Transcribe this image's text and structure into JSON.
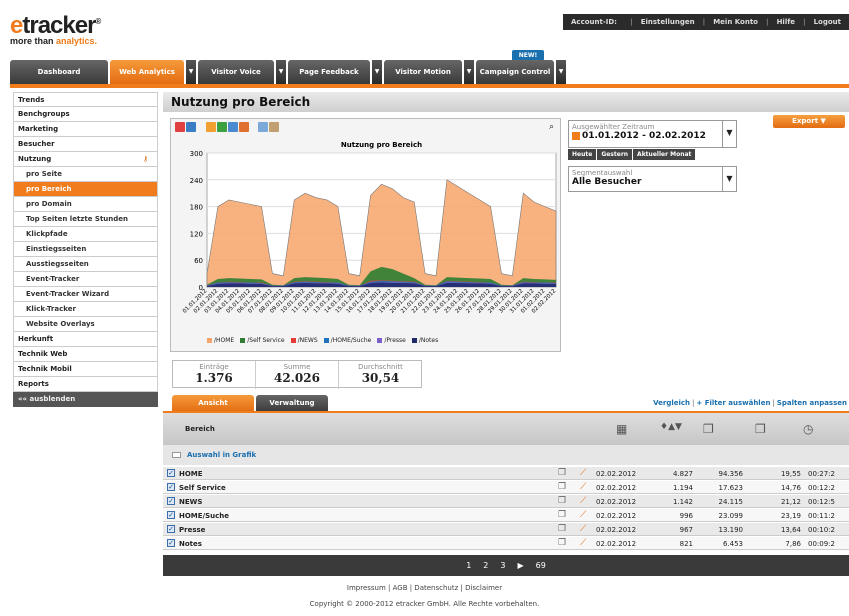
{
  "logo": {
    "brand_e": "e",
    "brand_rest": "tracker",
    "reg": "®",
    "tag_a": "more than ",
    "tag_b": "analytics."
  },
  "topbar": {
    "account_label": "Account-ID:",
    "links": [
      "Einstellungen",
      "Mein Konto",
      "Hilfe",
      "Logout"
    ]
  },
  "new_badge": "NEW!",
  "nav": {
    "tabs": [
      "Dashboard",
      "Web Analytics",
      "Visitor Voice",
      "Page Feedback",
      "Visitor Motion",
      "Campaign Control"
    ],
    "active": "Web Analytics",
    "arrow_icon": "dropdown-arrow-icon"
  },
  "sidebar": {
    "items": [
      {
        "label": "Trends",
        "type": "top"
      },
      {
        "label": "Benchgroups",
        "type": "top"
      },
      {
        "label": "Marketing",
        "type": "top"
      },
      {
        "label": "Besucher",
        "type": "top"
      },
      {
        "label": "Nutzung",
        "type": "top",
        "icon": "key-icon"
      },
      {
        "label": "pro Seite",
        "type": "sub"
      },
      {
        "label": "pro Bereich",
        "type": "sub",
        "active": true
      },
      {
        "label": "pro Domain",
        "type": "sub"
      },
      {
        "label": "Top Seiten letzte Stunden",
        "type": "sub"
      },
      {
        "label": "Klickpfade",
        "type": "sub"
      },
      {
        "label": "Einstiegsseiten",
        "type": "sub"
      },
      {
        "label": "Ausstiegsseiten",
        "type": "sub"
      },
      {
        "label": "Event-Tracker",
        "type": "sub"
      },
      {
        "label": "Event-Tracker Wizard",
        "type": "sub"
      },
      {
        "label": "Klick-Tracker",
        "type": "sub"
      },
      {
        "label": "Website Overlays",
        "type": "sub"
      },
      {
        "label": "Herkunft",
        "type": "top"
      },
      {
        "label": "Technik Web",
        "type": "top"
      },
      {
        "label": "Technik Mobil",
        "type": "top"
      },
      {
        "label": "Reports",
        "type": "top"
      }
    ],
    "hide_label": "«« ausblenden"
  },
  "page_title": "Nutzung pro Bereich",
  "export_label": "Export",
  "period": {
    "label": "Ausgewählter Zeitraum",
    "value": "01.01.2012 - 02.02.2012",
    "quick": [
      "Heute",
      "Gestern",
      "Aktueller Monat"
    ]
  },
  "segment": {
    "label": "Segmentauswahl",
    "value": "Alle Besucher"
  },
  "stats": [
    {
      "label": "Einträge",
      "value": "1.376"
    },
    {
      "label": "Summe",
      "value": "42.026"
    },
    {
      "label": "Durchschnitt",
      "value": "30,54"
    }
  ],
  "tabs": [
    "Ansicht",
    "Verwaltung"
  ],
  "table_links": [
    "Vergleich",
    "+ Filter auswählen",
    "Spalten anpassen"
  ],
  "table": {
    "header": "Bereich",
    "subheader": "Auswahl in Grafik",
    "rows": [
      {
        "name": "HOME",
        "date": "02.02.2012",
        "c1": "4.827",
        "c2": "94.356",
        "c3": "19,55",
        "c4": "00:27:2"
      },
      {
        "name": "Self Service",
        "date": "02.02.2012",
        "c1": "1.194",
        "c2": "17.623",
        "c3": "14,76",
        "c4": "00:12:2"
      },
      {
        "name": "NEWS",
        "date": "02.02.2012",
        "c1": "1.142",
        "c2": "24.115",
        "c3": "21,12",
        "c4": "00:12:5"
      },
      {
        "name": "HOME/Suche",
        "date": "02.02.2012",
        "c1": "996",
        "c2": "23.099",
        "c3": "23,19",
        "c4": "00:11:2"
      },
      {
        "name": "Presse",
        "date": "02.02.2012",
        "c1": "967",
        "c2": "13.190",
        "c3": "13,64",
        "c4": "00:10:2"
      },
      {
        "name": "Notes",
        "date": "02.02.2012",
        "c1": "821",
        "c2": "6.453",
        "c3": "7,86",
        "c4": "00:09:2"
      }
    ]
  },
  "pager": {
    "pages": [
      "1",
      "2",
      "3"
    ],
    "next": "▶",
    "last": "69"
  },
  "footer": {
    "links": "Impressum | AGB | Datenschutz | Disclaimer",
    "copyright": "Copyright © 2000-2012 etracker GmbH. Alle Rechte vorbehalten."
  },
  "colors": {
    "accent": "#f07c1b",
    "home": "#f7a46a",
    "self_service": "#2e7d32",
    "news": "#e53935",
    "suche": "#1e73be",
    "presse": "#7b5fc9",
    "notes": "#1f2a6b"
  },
  "chart_data": {
    "type": "area",
    "title": "Nutzung pro Bereich",
    "ylim": [
      0,
      300
    ],
    "yticks": [
      0,
      60,
      120,
      180,
      240,
      300
    ],
    "x": [
      "01.01.2012",
      "02.01.2012",
      "03.01.2012",
      "04.01.2012",
      "05.01.2012",
      "06.01.2012",
      "07.01.2012",
      "08.01.2012",
      "09.01.2012",
      "10.01.2012",
      "11.01.2012",
      "12.01.2012",
      "13.01.2012",
      "14.01.2012",
      "15.01.2012",
      "16.01.2012",
      "17.01.2012",
      "18.01.2012",
      "19.01.2012",
      "20.01.2012",
      "21.01.2012",
      "22.01.2012",
      "23.01.2012",
      "24.01.2012",
      "25.01.2012",
      "26.01.2012",
      "27.01.2012",
      "28.01.2012",
      "29.01.2012",
      "30.01.2012",
      "31.01.2012",
      "01.02.2012",
      "02.02.2012"
    ],
    "series": [
      {
        "name": "/HOME",
        "values": [
          30,
          180,
          195,
          190,
          185,
          180,
          30,
          25,
          195,
          210,
          200,
          195,
          180,
          30,
          25,
          205,
          230,
          220,
          200,
          190,
          30,
          25,
          240,
          225,
          210,
          195,
          180,
          30,
          25,
          210,
          190,
          180,
          170
        ]
      },
      {
        "name": "/Self Service",
        "values": [
          5,
          18,
          20,
          19,
          18,
          17,
          5,
          4,
          20,
          22,
          21,
          20,
          18,
          5,
          4,
          35,
          45,
          40,
          30,
          20,
          5,
          4,
          22,
          21,
          20,
          19,
          18,
          5,
          4,
          20,
          18,
          17,
          16
        ]
      },
      {
        "name": "/NEWS",
        "values": [
          3,
          10,
          12,
          11,
          10,
          10,
          3,
          3,
          12,
          13,
          12,
          11,
          10,
          3,
          3,
          14,
          15,
          14,
          13,
          12,
          3,
          3,
          14,
          13,
          12,
          11,
          10,
          3,
          3,
          12,
          11,
          10,
          10
        ]
      },
      {
        "name": "/HOME/Suche",
        "values": [
          3,
          10,
          11,
          10,
          10,
          9,
          3,
          3,
          11,
          12,
          11,
          10,
          10,
          3,
          3,
          12,
          14,
          13,
          12,
          11,
          3,
          3,
          13,
          12,
          11,
          10,
          10,
          3,
          3,
          11,
          10,
          10,
          9
        ]
      },
      {
        "name": "/Presse",
        "values": [
          3,
          8,
          9,
          9,
          8,
          8,
          2,
          2,
          9,
          10,
          9,
          9,
          8,
          2,
          2,
          10,
          11,
          10,
          10,
          9,
          2,
          2,
          10,
          10,
          9,
          9,
          8,
          2,
          2,
          9,
          9,
          8,
          8
        ]
      },
      {
        "name": "/Notes",
        "values": [
          2,
          7,
          8,
          8,
          7,
          7,
          2,
          2,
          8,
          9,
          8,
          8,
          7,
          2,
          2,
          9,
          10,
          9,
          9,
          8,
          2,
          2,
          9,
          9,
          8,
          8,
          7,
          2,
          2,
          8,
          8,
          7,
          7
        ]
      }
    ]
  }
}
